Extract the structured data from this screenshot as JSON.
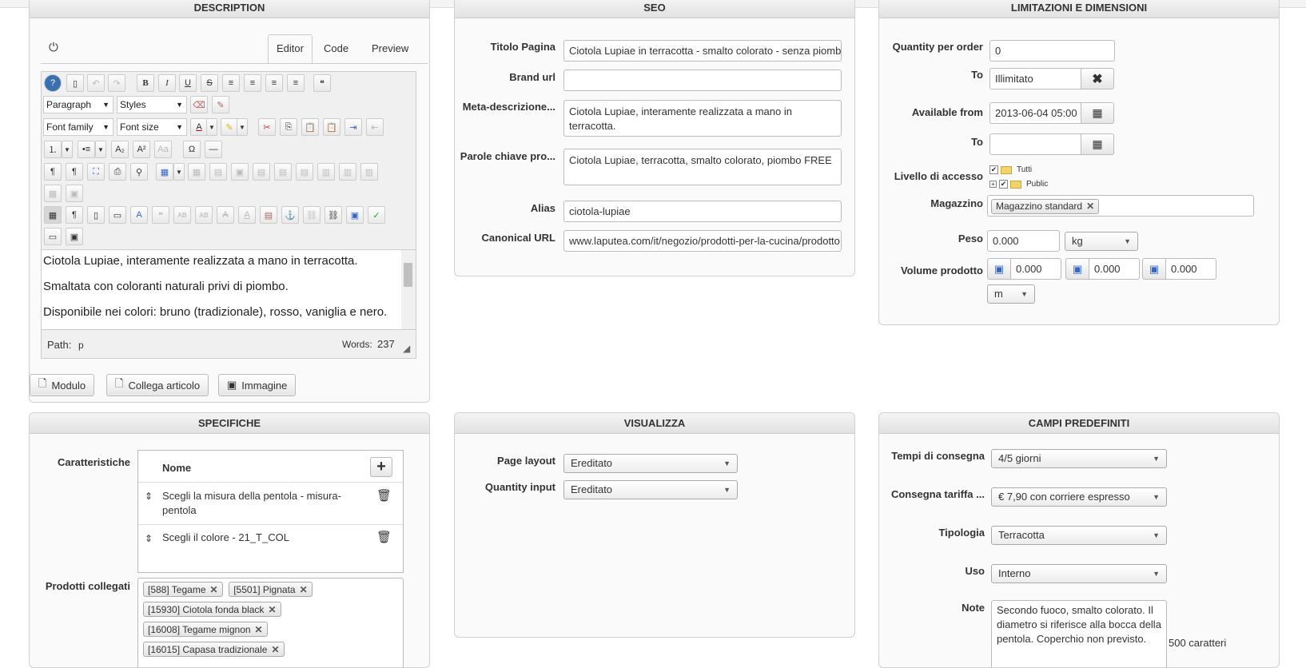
{
  "description": {
    "title": "DESCRIPTION",
    "tabs": [
      "Editor",
      "Code",
      "Preview"
    ],
    "toolbar": {
      "paragraph": "Paragraph",
      "styles": "Styles",
      "font_family": "Font family",
      "font_size": "Font size"
    },
    "content": [
      "Ciotola Lupiae, interamente realizzata a mano in terracotta.",
      "Smaltata con coloranti naturali privi di piombo.",
      "Disponibile nei colori: bruno (tradizionale), rosso, vaniglia e nero."
    ],
    "path_label": "Path:",
    "path_value": "p",
    "words_label": "Words:",
    "words_value": "237",
    "buttons": {
      "modulo": "Modulo",
      "collega": "Collega articolo",
      "immagine": "Immagine"
    }
  },
  "seo": {
    "title": "SEO",
    "titolo_label": "Titolo Pagina",
    "titolo_value": "Ciotola Lupiae in terracotta - smalto colorato - senza piombo",
    "brand_label": "Brand url",
    "brand_value": "",
    "meta_label": "Meta-descrizione...",
    "meta_value": "Ciotola Lupiae, interamente realizzata a mano in terracotta.",
    "parole_label": "Parole chiave pro...",
    "parole_value": "Ciotola Lupiae, terracotta, smalto colorato, piombo FREE",
    "alias_label": "Alias",
    "alias_value": "ciotola-lupiae",
    "canonical_label": "Canonical URL",
    "canonical_value": "www.laputea.com/it/negozio/prodotti-per-la-cucina/prodotto"
  },
  "limiti": {
    "title": "LIMITAZIONI E DIMENSIONI",
    "qty_label": "Quantity per order",
    "qty_value": "0",
    "to_label": "To",
    "to_value": "Illimitato",
    "avail_label": "Available from",
    "avail_value": "2013-06-04 05:00",
    "to2_label": "To",
    "to2_value": "",
    "livello_label": "Livello di accesso",
    "tree": [
      "Tutti",
      "Public"
    ],
    "magazzino_label": "Magazzino",
    "magazzino_tag": "Magazzino standard",
    "peso_label": "Peso",
    "peso_value": "0.000",
    "peso_unit": "kg",
    "volume_label": "Volume prodotto",
    "volume_values": [
      "0.000",
      "0.000",
      "0.000"
    ],
    "volume_unit": "m"
  },
  "specifiche": {
    "title": "SPECIFICHE",
    "caratteristiche_label": "Caratteristiche",
    "col_nome": "Nome",
    "rows": [
      "Scegli la misura della pentola - misura-pentola",
      "Scegli il colore - 21_T_COL"
    ],
    "prodotti_label": "Prodotti collegati",
    "prodotti": [
      "[588] Tegame",
      "[5501] Pignata",
      "[15930] Ciotola fonda black",
      "[16008] Tegame mignon",
      "[16015] Capasa tradizionale"
    ]
  },
  "visualizza": {
    "title": "VISUALIZZA",
    "layout_label": "Page layout",
    "layout_value": "Ereditato",
    "qinput_label": "Quantity input",
    "qinput_value": "Ereditato"
  },
  "campi": {
    "title": "CAMPI PREDEFINITI",
    "tempi_label": "Tempi di consegna",
    "tempi_value": "4/5 giorni",
    "tariffa_label": "Consegna tariffa ...",
    "tariffa_value": "€ 7,90 con corriere espresso",
    "tipologia_label": "Tipologia",
    "tipologia_value": "Terracotta",
    "uso_label": "Uso",
    "uso_value": "Interno",
    "note_label": "Note",
    "note_value": "Secondo fuoco, smalto colorato. Il diametro si riferisce alla bocca della pentola. Coperchio non previsto.",
    "caratteri": "500 caratteri"
  }
}
